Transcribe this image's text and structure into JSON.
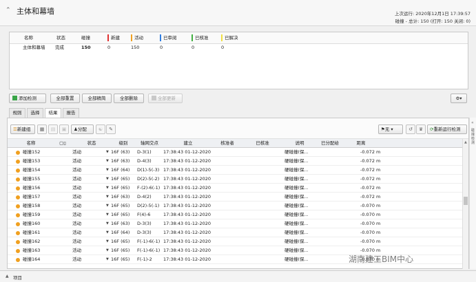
{
  "header": {
    "title": "主体和幕墙",
    "last_run": "上次运行: 2020年12月1日 17:39:57",
    "summary": "碰撞 - 总计: 150 (打开: 150 关闭: 0)"
  },
  "tests_table": {
    "columns": [
      "名称",
      "状态",
      "碰撞",
      "新建",
      "活动",
      "已审阅",
      "已核准",
      "已解决"
    ],
    "status_colors": {
      "新建": "#e03030",
      "活动": "#f0a020",
      "已审阅": "#2f7de0",
      "已核准": "#40b040",
      "已解决": "#f0e040"
    },
    "row": {
      "name": "主体和幕墙",
      "status": "完成",
      "clashes": "150",
      "new": "0",
      "active": "150",
      "reviewed": "0",
      "approved": "0",
      "resolved": "0"
    }
  },
  "test_buttons": {
    "add_test": "添加检测",
    "reset_all": "全部重置",
    "compact_all": "全部精简",
    "delete_all": "全部删除",
    "update_all": "全部更新"
  },
  "tabs": [
    "规则",
    "选择",
    "结果",
    "报告"
  ],
  "results_toolbar": {
    "new_group": "新建组",
    "assign": "分配",
    "display": "无",
    "rerun": "重新运行检测"
  },
  "grid": {
    "columns": [
      "名称",
      "",
      "状态",
      "级别",
      "轴网交点",
      "建立",
      "核准者",
      "已核准",
      "说明",
      "已分配给",
      "距离"
    ],
    "rows": [
      {
        "name": "碰撞152",
        "status": "活动",
        "level": "16F (63)",
        "grid": "D-3(1)",
        "created": "17:38:43 01-12-2020",
        "desc": "硬碰撞(保...",
        "dist": "-0.072 m"
      },
      {
        "name": "碰撞153",
        "status": "活动",
        "level": "16F (63)",
        "grid": "D-4(3)",
        "created": "17:38:43 01-12-2020",
        "desc": "硬碰撞(保...",
        "dist": "-0.072 m"
      },
      {
        "name": "碰撞154",
        "status": "活动",
        "level": "16F (64)",
        "grid": "D(1)-5(-3)",
        "created": "17:38:43 01-12-2020",
        "desc": "硬碰撞(保...",
        "dist": "-0.072 m"
      },
      {
        "name": "碰撞155",
        "status": "活动",
        "level": "16F (65)",
        "grid": "D(2)-5(-2)",
        "created": "17:38:43 01-12-2020",
        "desc": "硬碰撞(保...",
        "dist": "-0.072 m"
      },
      {
        "name": "碰撞156",
        "status": "活动",
        "level": "16F (65)",
        "grid": "F-(2)-6(-1)",
        "created": "17:38:43 01-12-2020",
        "desc": "硬碰撞(保...",
        "dist": "-0.072 m"
      },
      {
        "name": "碰撞157",
        "status": "活动",
        "level": "16F (63)",
        "grid": "D-4(2)",
        "created": "17:38:43 01-12-2020",
        "desc": "硬碰撞(保...",
        "dist": "-0.072 m"
      },
      {
        "name": "碰撞158",
        "status": "活动",
        "level": "16F (65)",
        "grid": "D(2)-5(-1)",
        "created": "17:38:43 01-12-2020",
        "desc": "硬碰撞(保...",
        "dist": "-0.070 m"
      },
      {
        "name": "碰撞159",
        "status": "活动",
        "level": "16F (65)",
        "grid": "F(4)-6",
        "created": "17:38:43 01-12-2020",
        "desc": "硬碰撞(保...",
        "dist": "-0.070 m"
      },
      {
        "name": "碰撞160",
        "status": "活动",
        "level": "16F (63)",
        "grid": "D-3(3)",
        "created": "17:38:43 01-12-2020",
        "desc": "硬碰撞(保...",
        "dist": "-0.070 m"
      },
      {
        "name": "碰撞161",
        "status": "活动",
        "level": "16F (64)",
        "grid": "D-3(3)",
        "created": "17:38:43 01-12-2020",
        "desc": "硬碰撞(保...",
        "dist": "-0.070 m"
      },
      {
        "name": "碰撞162",
        "status": "活动",
        "level": "16F (65)",
        "grid": "F(-1)-6(-1)",
        "created": "17:38:43 01-12-2020",
        "desc": "硬碰撞(保...",
        "dist": "-0.070 m"
      },
      {
        "name": "碰撞163",
        "status": "活动",
        "level": "16F (65)",
        "grid": "F(-1)-6(-1)",
        "created": "17:38:43 01-12-2020",
        "desc": "硬碰撞(保...",
        "dist": "-0.070 m"
      },
      {
        "name": "碰撞164",
        "status": "活动",
        "level": "16F (65)",
        "grid": "F(-1)-2",
        "created": "17:38:43 01-12-2020",
        "desc": "硬碰撞(保...",
        "dist": "-0.070 m"
      }
    ]
  },
  "side_panel_label": "碰撞检测",
  "bottom_bar": {
    "label": "项目"
  },
  "watermark": "湖南建工BIM中心"
}
